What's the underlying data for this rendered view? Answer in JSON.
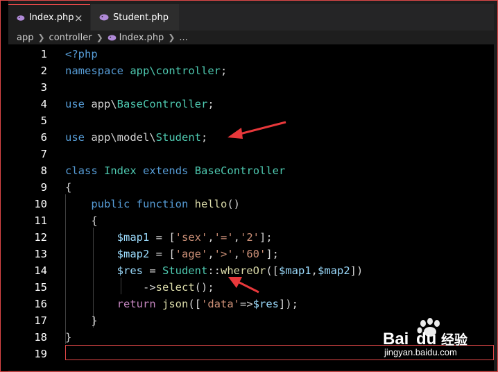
{
  "tabs": [
    {
      "label": "Index.php",
      "icon": "php-elephant-icon",
      "active": true,
      "close": "×"
    },
    {
      "label": "Student.php",
      "icon": "php-elephant-icon",
      "active": false
    }
  ],
  "breadcrumb": [
    "app",
    "controller",
    "Index.php",
    "..."
  ],
  "code_lines": [
    {
      "n": "1",
      "tokens": [
        [
          "c-tag",
          "<?php"
        ]
      ]
    },
    {
      "n": "2",
      "tokens": [
        [
          "c-kw",
          "namespace"
        ],
        [
          "c-txt",
          " "
        ],
        [
          "c-cls",
          "app\\controller"
        ],
        [
          "c-txt",
          ";"
        ]
      ]
    },
    {
      "n": "3",
      "tokens": []
    },
    {
      "n": "4",
      "tokens": [
        [
          "c-kw",
          "use"
        ],
        [
          "c-txt",
          " app\\"
        ],
        [
          "c-cls",
          "BaseController"
        ],
        [
          "c-txt",
          ";"
        ]
      ]
    },
    {
      "n": "5",
      "tokens": []
    },
    {
      "n": "6",
      "tokens": [
        [
          "c-kw",
          "use"
        ],
        [
          "c-txt",
          " app\\model\\"
        ],
        [
          "c-cls",
          "Student"
        ],
        [
          "c-txt",
          ";"
        ]
      ]
    },
    {
      "n": "7",
      "tokens": []
    },
    {
      "n": "8",
      "tokens": [
        [
          "c-kw",
          "class"
        ],
        [
          "c-txt",
          " "
        ],
        [
          "c-cls",
          "Index"
        ],
        [
          "c-txt",
          " "
        ],
        [
          "c-kw",
          "extends"
        ],
        [
          "c-txt",
          " "
        ],
        [
          "c-cls",
          "BaseController"
        ]
      ]
    },
    {
      "n": "9",
      "tokens": [
        [
          "c-txt",
          "{"
        ]
      ]
    },
    {
      "n": "10",
      "tokens": [
        [
          "c-txt",
          "    "
        ],
        [
          "c-kw",
          "public"
        ],
        [
          "c-txt",
          " "
        ],
        [
          "c-kw",
          "function"
        ],
        [
          "c-txt",
          " "
        ],
        [
          "c-fn",
          "hello"
        ],
        [
          "c-txt",
          "()"
        ]
      ]
    },
    {
      "n": "11",
      "tokens": [
        [
          "c-txt",
          "    {"
        ]
      ]
    },
    {
      "n": "12",
      "tokens": [
        [
          "c-txt",
          "        "
        ],
        [
          "c-var",
          "$map1"
        ],
        [
          "c-txt",
          " = ["
        ],
        [
          "c-str",
          "'sex'"
        ],
        [
          "c-txt",
          ","
        ],
        [
          "c-str",
          "'='"
        ],
        [
          "c-txt",
          ","
        ],
        [
          "c-str",
          "'2'"
        ],
        [
          "c-txt",
          "];"
        ]
      ]
    },
    {
      "n": "13",
      "tokens": [
        [
          "c-txt",
          "        "
        ],
        [
          "c-var",
          "$map2"
        ],
        [
          "c-txt",
          " = ["
        ],
        [
          "c-str",
          "'age'"
        ],
        [
          "c-txt",
          ","
        ],
        [
          "c-str",
          "'>'"
        ],
        [
          "c-txt",
          ","
        ],
        [
          "c-str",
          "'60'"
        ],
        [
          "c-txt",
          "];"
        ]
      ]
    },
    {
      "n": "14",
      "tokens": [
        [
          "c-txt",
          "        "
        ],
        [
          "c-var",
          "$res"
        ],
        [
          "c-txt",
          " = "
        ],
        [
          "c-cls",
          "Student"
        ],
        [
          "c-txt",
          "::"
        ],
        [
          "c-fn",
          "whereOr"
        ],
        [
          "c-txt",
          "(["
        ],
        [
          "c-var",
          "$map1"
        ],
        [
          "c-txt",
          ","
        ],
        [
          "c-var",
          "$map2"
        ],
        [
          "c-txt",
          "])"
        ]
      ]
    },
    {
      "n": "15",
      "tokens": [
        [
          "c-txt",
          "            ->"
        ],
        [
          "c-fn",
          "select"
        ],
        [
          "c-txt",
          "();"
        ]
      ]
    },
    {
      "n": "16",
      "tokens": [
        [
          "c-txt",
          "        "
        ],
        [
          "c-ctl",
          "return"
        ],
        [
          "c-txt",
          " "
        ],
        [
          "c-fn",
          "json"
        ],
        [
          "c-txt",
          "(["
        ],
        [
          "c-str",
          "'data'"
        ],
        [
          "c-txt",
          "=>"
        ],
        [
          "c-var",
          "$res"
        ],
        [
          "c-txt",
          "]);"
        ]
      ]
    },
    {
      "n": "17",
      "tokens": [
        [
          "c-txt",
          "    }"
        ]
      ]
    },
    {
      "n": "18",
      "tokens": [
        [
          "c-txt",
          "}"
        ]
      ]
    },
    {
      "n": "19",
      "tokens": []
    }
  ],
  "watermark": {
    "brand": "Bai",
    "brand2": "du",
    "cn": "经验",
    "url": "jingyan.baidu.com"
  },
  "colors": {
    "accent": "#e04848",
    "keyword": "#569cd6",
    "class": "#4ec9b0",
    "variable": "#9cdcfe",
    "string": "#ce9178",
    "function": "#dcdcaa"
  }
}
